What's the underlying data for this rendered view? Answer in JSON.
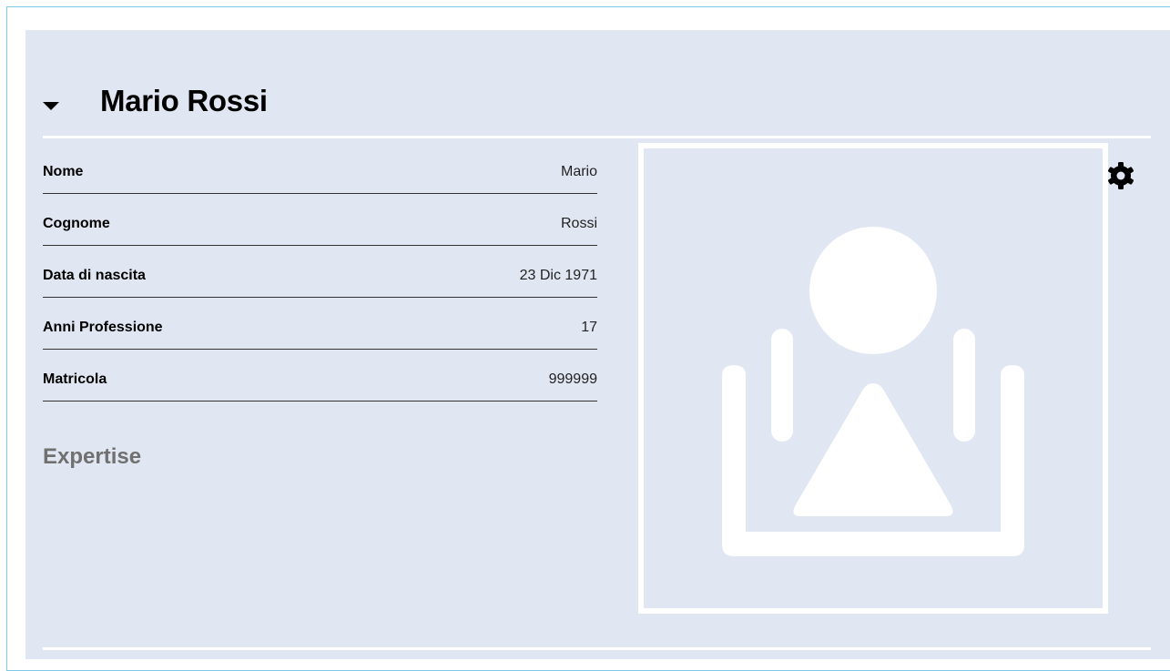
{
  "profile": {
    "name": "Mario Rossi"
  },
  "fields": [
    {
      "label": "Nome",
      "value": "Mario"
    },
    {
      "label": "Cognome",
      "value": "Rossi"
    },
    {
      "label": "Data di nascita",
      "value": "23 Dic 1971"
    },
    {
      "label": "Anni Professione",
      "value": "17"
    },
    {
      "label": "Matricola",
      "value": "999999"
    }
  ],
  "expertise": {
    "title": "Expertise"
  },
  "icons": {
    "collapse": "caret-down-icon",
    "settings": "gear-icon",
    "photo_placeholder": "person-placeholder-icon"
  },
  "colors": {
    "panel_bg": "#e1e7f2",
    "frame_border": "#7fc8e8",
    "divider": "#ffffff",
    "expertise_text": "#707070"
  }
}
